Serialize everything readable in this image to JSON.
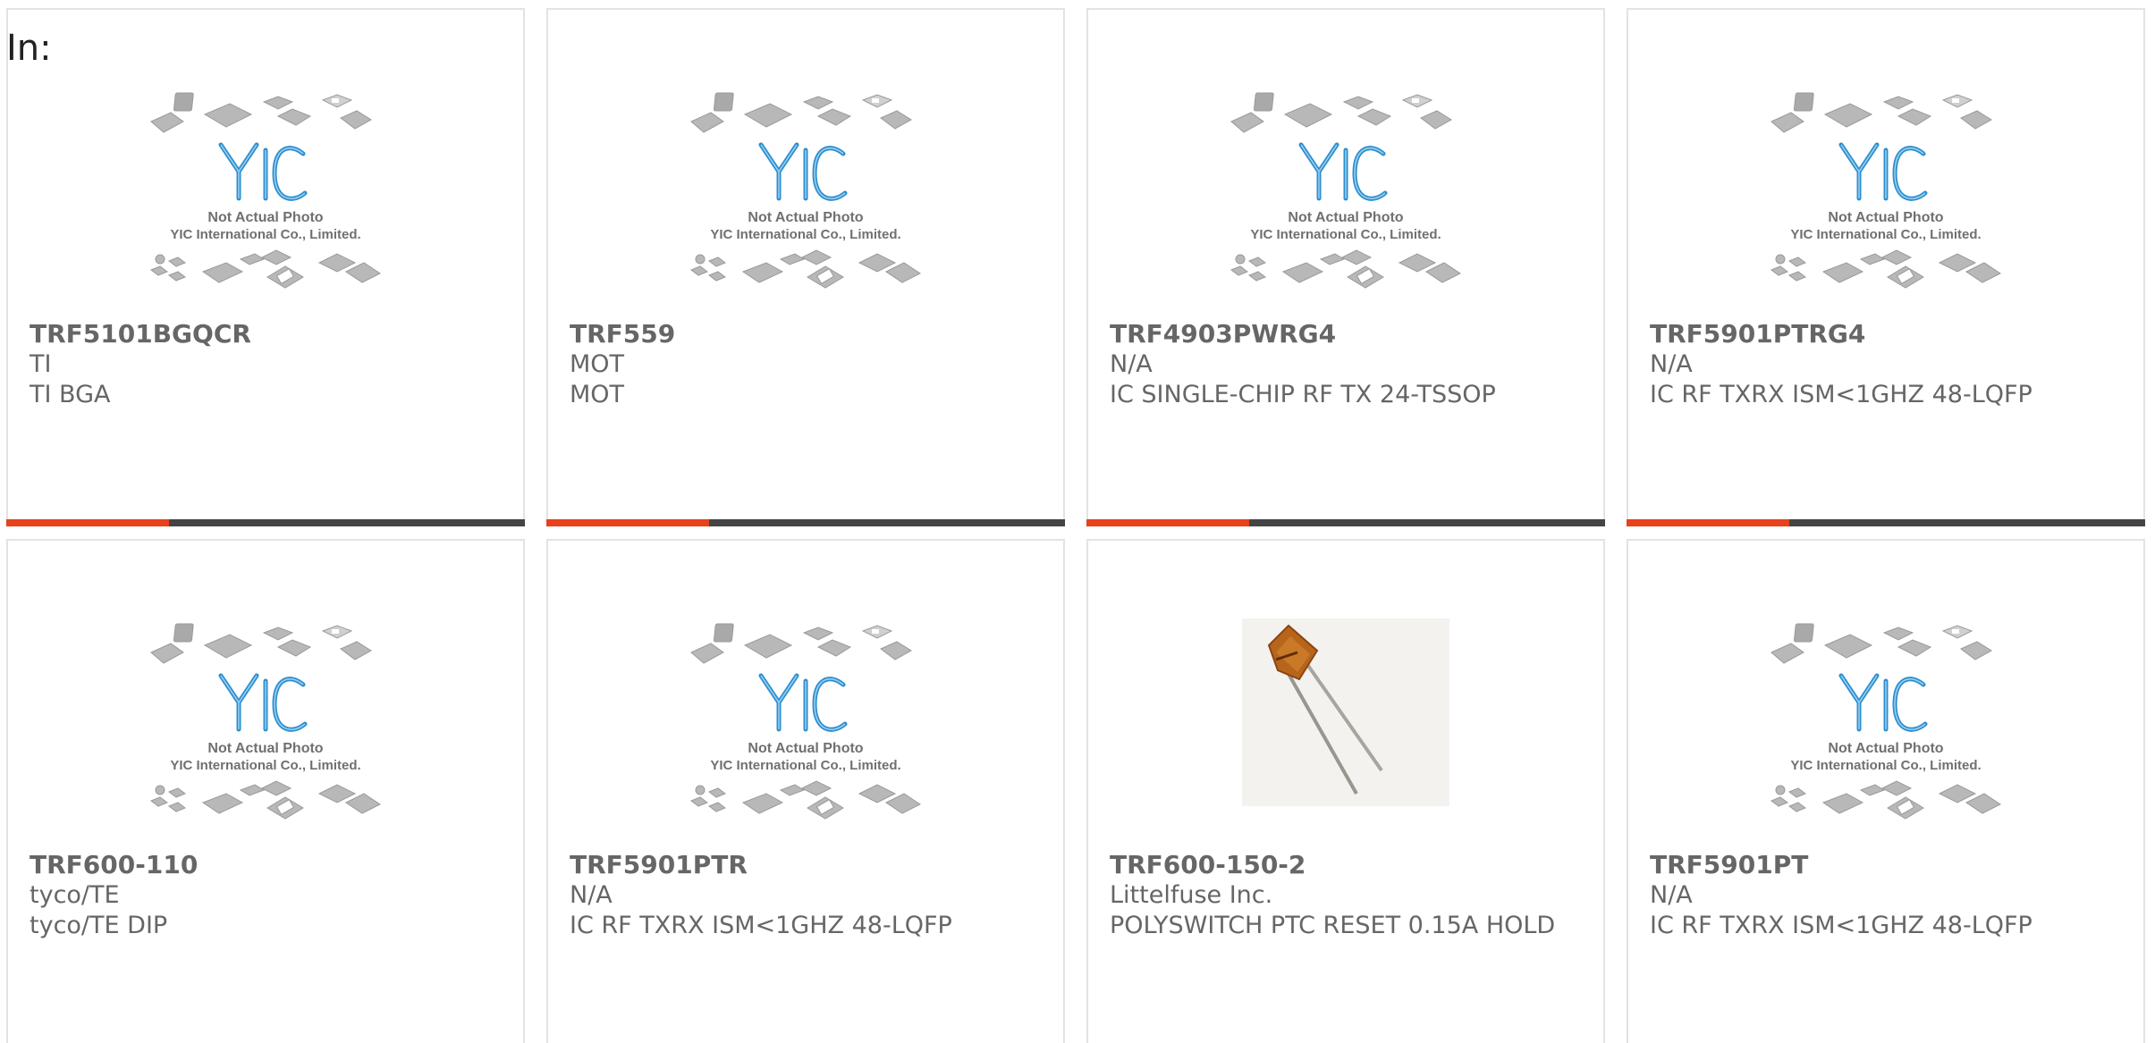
{
  "heading": "In:",
  "accent_color": "#e8411b",
  "bar_color": "#444444",
  "placeholder": {
    "line1": "Not Actual Photo",
    "line2": "YIC International Co., Limited.",
    "logo_text": "YIC"
  },
  "products": [
    {
      "part": "TRF5101BGQCR",
      "manufacturer": "TI",
      "description": "TI BGA",
      "image": "placeholder"
    },
    {
      "part": "TRF559",
      "manufacturer": "MOT",
      "description": "MOT",
      "image": "placeholder"
    },
    {
      "part": "TRF4903PWRG4",
      "manufacturer": "N/A",
      "description": "IC SINGLE-CHIP RF TX 24-TSSOP",
      "image": "placeholder"
    },
    {
      "part": "TRF5901PTRG4",
      "manufacturer": "N/A",
      "description": "IC RF TXRX ISM<1GHZ 48-LQFP",
      "image": "placeholder"
    },
    {
      "part": "TRF600-110",
      "manufacturer": "tyco/TE",
      "description": "tyco/TE DIP",
      "image": "placeholder"
    },
    {
      "part": "TRF5901PTR",
      "manufacturer": "N/A",
      "description": "IC RF TXRX ISM<1GHZ 48-LQFP",
      "image": "placeholder"
    },
    {
      "part": "TRF600-150-2",
      "manufacturer": "Littelfuse Inc.",
      "description": "POLYSWITCH PTC RESET 0.15A HOLD",
      "image": "ptc-fuse"
    },
    {
      "part": "TRF5901PT",
      "manufacturer": "N/A",
      "description": "IC RF TXRX ISM<1GHZ 48-LQFP",
      "image": "placeholder"
    }
  ]
}
